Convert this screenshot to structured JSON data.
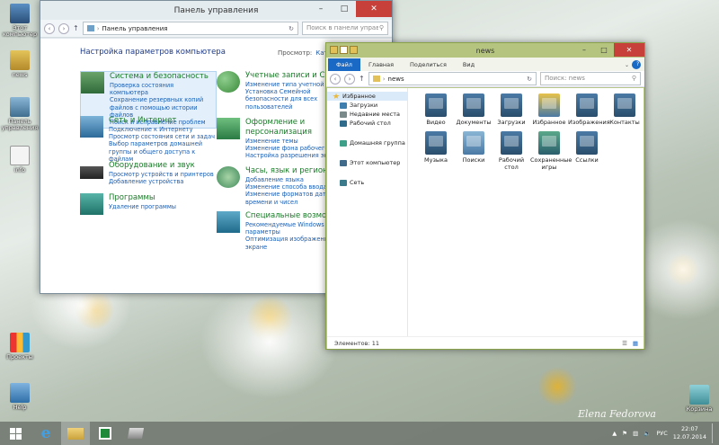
{
  "desktop": {
    "icons": [
      {
        "label": "Этот компьютер",
        "pos": "left-1"
      },
      {
        "label": "news",
        "pos": "left-2"
      },
      {
        "label": "Панель управления",
        "pos": "left-3"
      },
      {
        "label": "info",
        "pos": "left-4"
      },
      {
        "label": "Проекты",
        "pos": "left-5"
      },
      {
        "label": "Help",
        "pos": "left-6"
      },
      {
        "label": "Корзина",
        "pos": "right-1"
      }
    ],
    "signature": "Elena Fedorova"
  },
  "control_panel": {
    "title": "Панель управления",
    "address": "Панель управления",
    "search_placeholder": "Поиск в панели управления",
    "heading": "Настройка параметров компьютера",
    "view_label": "Просмотр:",
    "view_value": "Категория",
    "categories": [
      {
        "title": "Система и безопасность",
        "links": [
          "Проверка состояния компьютера",
          "Сохранение резервных копий файлов с помощью истории файлов",
          "Поиск и исправление проблем"
        ]
      },
      {
        "title": "Сеть и Интернет",
        "links": [
          "Подключение к Интернету",
          "Просмотр состояния сети и задач",
          "Выбор параметров домашней группы и общего доступа к файлам"
        ]
      },
      {
        "title": "Оборудование и звук",
        "links": [
          "Просмотр устройств и принтеров",
          "Добавление устройства"
        ]
      },
      {
        "title": "Программы",
        "links": [
          "Удаление программы"
        ]
      },
      {
        "title": "Учетные записи и Семейная безопасность",
        "links": [
          "Изменение типа учетной записи",
          "Установка Семейной безопасности для всех пользователей"
        ]
      },
      {
        "title": "Оформление и персонализация",
        "links": [
          "Изменение темы",
          "Изменение фона рабочего стола",
          "Настройка разрешения экрана"
        ]
      },
      {
        "title": "Часы, язык и регион",
        "links": [
          "Добавление языка",
          "Изменение способа ввода",
          "Изменение форматов даты, времени и чисел"
        ]
      },
      {
        "title": "Специальные возможности",
        "links": [
          "Рекомендуемые Windows параметры",
          "Оптимизация изображения на экране"
        ]
      }
    ]
  },
  "explorer": {
    "title": "news",
    "ribbon_tabs": [
      "Файл",
      "Главная",
      "Поделиться",
      "Вид"
    ],
    "address": "news",
    "search_placeholder": "Поиск: news",
    "tree": [
      {
        "label": "Избранное",
        "type": "star",
        "selected": true
      },
      {
        "label": "Загрузки",
        "type": "child"
      },
      {
        "label": "Недавние места",
        "type": "child"
      },
      {
        "label": "Рабочий стол",
        "type": "child"
      },
      {
        "label": "Домашняя группа",
        "type": "root"
      },
      {
        "label": "Этот компьютер",
        "type": "root"
      },
      {
        "label": "Сеть",
        "type": "root"
      }
    ],
    "items": [
      "Видео",
      "Документы",
      "Загрузки",
      "Избранное",
      "Изображения",
      "Контакты",
      "Музыка",
      "Поиски",
      "Рабочий стол",
      "Сохраненные игры",
      "Ссылки"
    ],
    "status": "Элементов: 11"
  },
  "taskbar": {
    "language": "РУС",
    "time": "22:07",
    "date": "12.07.2014"
  },
  "colors": {
    "explorer_frame": "#b5c47f",
    "accent_file_tab": "#1a69c4",
    "category_title": "#1a7a28",
    "link": "#1a5fb4",
    "close_button": "#c7413a"
  }
}
